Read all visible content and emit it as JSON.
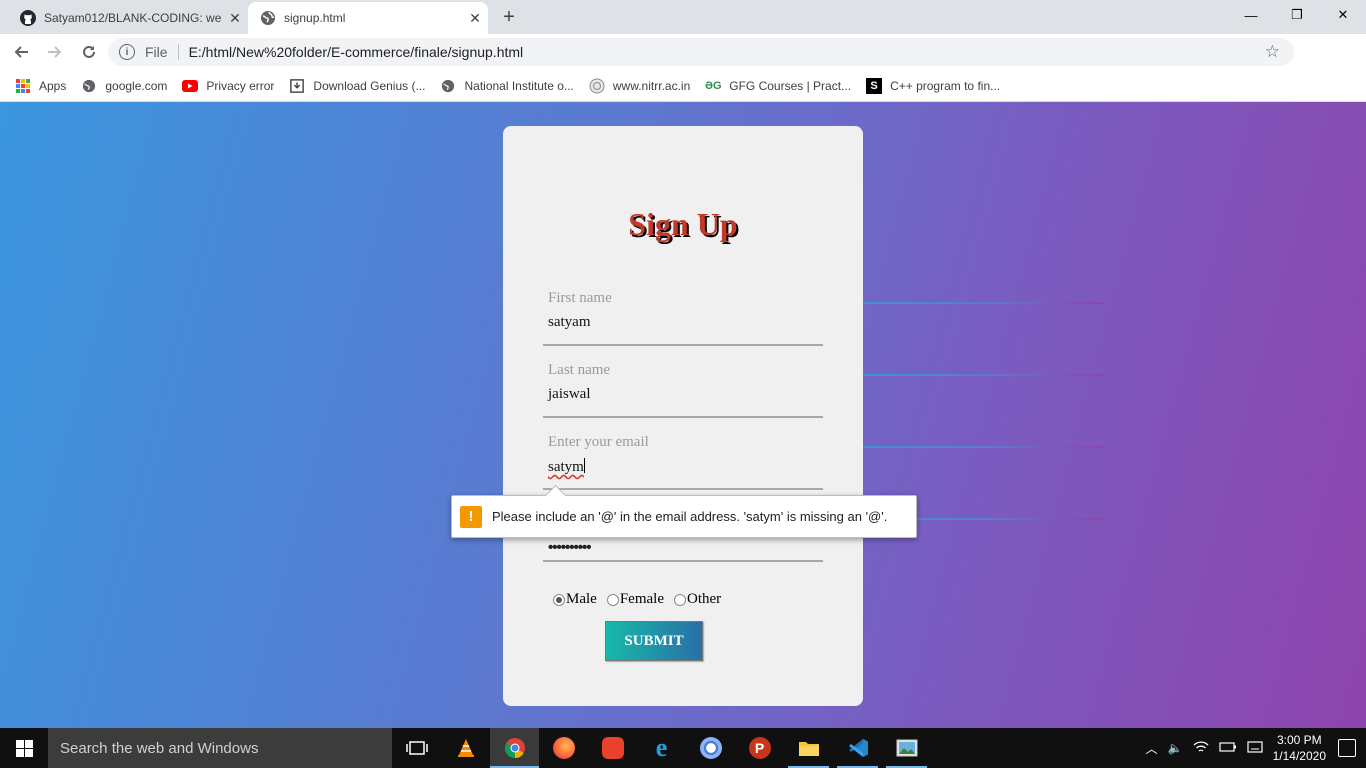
{
  "browser": {
    "tabs": [
      {
        "title": "Satyam012/BLANK-CODING: web",
        "icon": "github-icon"
      },
      {
        "title": "signup.html",
        "icon": "globe-icon"
      }
    ],
    "url_scheme_label": "File",
    "url": "E:/html/New%20folder/E-commerce/finale/signup.html",
    "bookmarks": [
      {
        "label": "Apps",
        "icon": "apps-grid-icon"
      },
      {
        "label": "google.com",
        "icon": "globe-icon"
      },
      {
        "label": "Privacy error",
        "icon": "youtube-icon"
      },
      {
        "label": "Download Genius (...",
        "icon": "download-icon"
      },
      {
        "label": "National Institute o...",
        "icon": "globe-icon"
      },
      {
        "label": "www.nitrr.ac.in",
        "icon": "seal-icon"
      },
      {
        "label": "GFG Courses | Pract...",
        "icon": "gfg-icon"
      },
      {
        "label": "C++ program to fin...",
        "icon": "s-icon"
      }
    ]
  },
  "form": {
    "title": "Sign Up",
    "fields": [
      {
        "label": "First name",
        "value": "satyam"
      },
      {
        "label": "Last name",
        "value": "jaiswal"
      },
      {
        "label": "Enter your email",
        "value": "satym"
      },
      {
        "label": "",
        "value": "••••••••••"
      }
    ],
    "gender_options": [
      "Male",
      "Female",
      "Other"
    ],
    "gender_selected": "Male",
    "submit_label": "SUBMIT"
  },
  "validation_message": "Please include an '@' in the email address. 'satym' is missing an '@'.",
  "taskbar": {
    "search_placeholder": "Search the web and Windows",
    "time": "3:00 PM",
    "date": "1/14/2020"
  },
  "colors": {
    "title": "#c0392b",
    "gradient_start": "#3a96dd",
    "gradient_end": "#8e44ad",
    "warning": "#f29900"
  }
}
